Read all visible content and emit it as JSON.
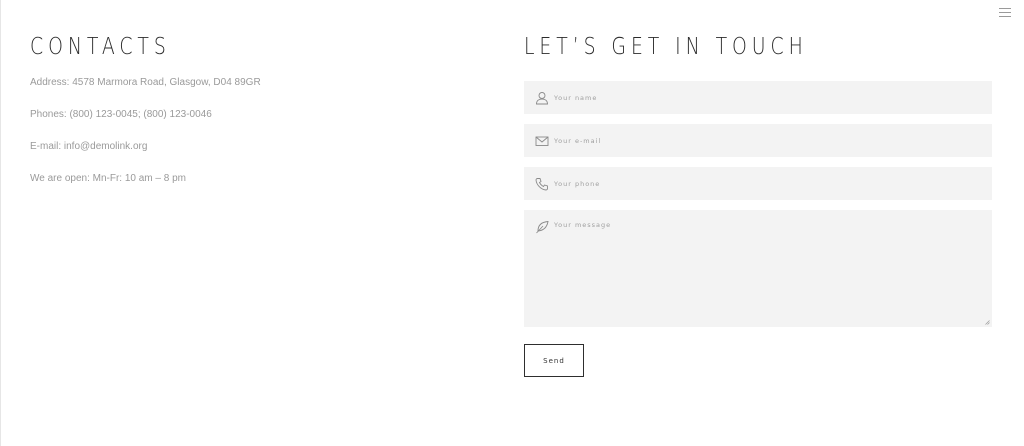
{
  "contacts": {
    "title": "CONTACTS",
    "address": "Address: 4578  Marmora Road, Glasgow, D04 89GR",
    "phones": "Phones: (800) 123-0045; (800) 123-0046",
    "email": "E-mail: info@demolink.org",
    "hours": "We are open: Mn-Fr: 10 am – 8 pm"
  },
  "form": {
    "title": "LET’S GET IN TOUCH",
    "name_placeholder": "Your name",
    "email_placeholder": "Your e-mail",
    "phone_placeholder": "Your phone",
    "message_placeholder": "Your message",
    "send_label": "Send"
  },
  "icons": {
    "menu": "hamburger-menu-icon",
    "name": "user-icon",
    "email": "envelope-icon",
    "phone": "phone-icon",
    "message": "feather-icon"
  },
  "colors": {
    "heading": "#2b2b2b",
    "body_text": "#9a9a9a",
    "field_bg": "#f3f3f3",
    "button_border": "#2e2e2e"
  }
}
